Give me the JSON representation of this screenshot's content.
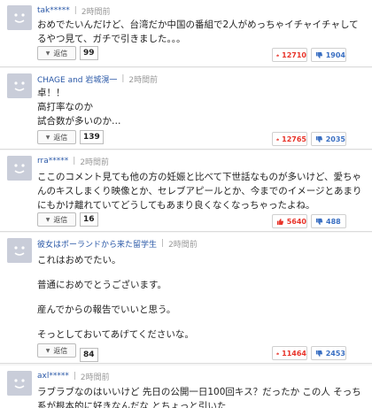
{
  "reply_label": "返信",
  "separator": "|",
  "colors": {
    "like": "#e8342a",
    "dislike": "#3a6fc2",
    "username": "#2a58a7",
    "avatar": "#c9cdd9"
  },
  "comments": [
    {
      "user": "tak*****",
      "time": "2時間前",
      "lines": [
        "おめでたいんだけど、台湾だか中国の番組で2人がめっちゃイチャイチャしてるやつ見て、ガチで引きました。。。"
      ],
      "reply_count": "99",
      "likes": "12710",
      "dislikes": "1904"
    },
    {
      "user": "CHAGE and 岩城滉一",
      "time": "2時間前",
      "lines": [
        "卓！！",
        "高打率なのか",
        "試合数が多いのか…"
      ],
      "reply_count": "139",
      "likes": "12765",
      "dislikes": "2035"
    },
    {
      "user": "rra*****",
      "time": "2時間前",
      "lines": [
        "ここのコメント見ても他の方の妊娠と比べて下世話なものが多いけど、愛ちゃんのキスしまくり映像とか、セレブアピールとか、今までのイメージとあまりにもかけ離れていてどうしてもあまり良くなくなっちゃったよね。"
      ],
      "reply_count": "16",
      "likes": "5640",
      "dislikes": "488"
    },
    {
      "user": "彼女はポーランドから来た留学生",
      "time": "2時間前",
      "lines": [
        "これはおめでたい。",
        "普通におめでとうございます。",
        "産んでからの報告でいいと思う。",
        "そっとしておいてあげてくださいな。"
      ],
      "reply_count": "84",
      "likes": "11464",
      "dislikes": "2453"
    },
    {
      "user": "axl*****",
      "time": "2時間前",
      "lines": [
        "ラブラブなのはいいけど 先日の公開一日100回キス？だったか この人 そっち系が根本的に好きなんだな とちょっと引いた"
      ],
      "reply_count": "",
      "likes": "",
      "dislikes": ""
    }
  ]
}
